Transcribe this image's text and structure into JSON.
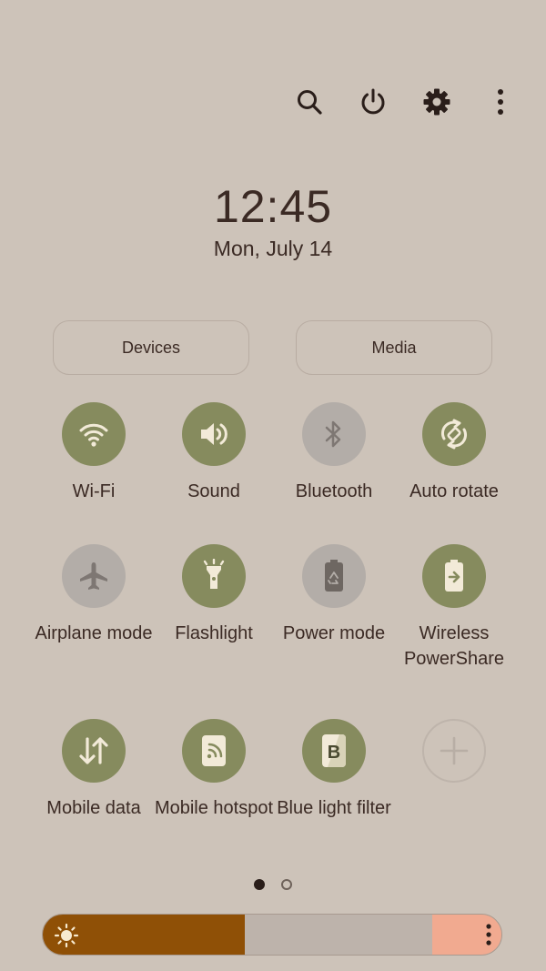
{
  "clock": {
    "time": "12:45",
    "date": "Mon, July 14"
  },
  "top_icons": [
    "search-icon",
    "power-icon",
    "settings-gear-icon",
    "more-vertical-icon"
  ],
  "buttons": {
    "devices": "Devices",
    "media": "Media"
  },
  "tiles": [
    {
      "label": "Wi-Fi",
      "icon": "wifi-icon",
      "state": "on"
    },
    {
      "label": "Sound",
      "icon": "sound-icon",
      "state": "on"
    },
    {
      "label": "Bluetooth",
      "icon": "bluetooth-icon",
      "state": "off"
    },
    {
      "label": "Auto rotate",
      "icon": "auto-rotate-icon",
      "state": "on"
    },
    {
      "label": "Airplane mode",
      "icon": "airplane-icon",
      "state": "off"
    },
    {
      "label": "Flashlight",
      "icon": "flashlight-icon",
      "state": "on"
    },
    {
      "label": "Power mode",
      "icon": "power-mode-icon",
      "state": "off"
    },
    {
      "label": "Wireless PowerShare",
      "icon": "wireless-powershare-icon",
      "state": "on"
    },
    {
      "label": "Mobile data",
      "icon": "mobile-data-icon",
      "state": "on"
    },
    {
      "label": "Mobile hotspot",
      "icon": "mobile-hotspot-icon",
      "state": "on"
    },
    {
      "label": "Blue light filter",
      "icon": "blue-light-filter-icon",
      "state": "on"
    },
    {
      "label": "",
      "icon": "add-icon",
      "state": "empty"
    }
  ],
  "pager": {
    "pages": 2,
    "current": 1
  },
  "brightness": {
    "level": 0.44,
    "icon": "sun-icon"
  },
  "colors": {
    "background": "#cdc3b9",
    "tile_on": "#868b5e",
    "tile_off": "#b3ada8",
    "brightness_fill": "#8f5006",
    "brightness_end": "#f1aa90",
    "text": "#3b2a24"
  }
}
